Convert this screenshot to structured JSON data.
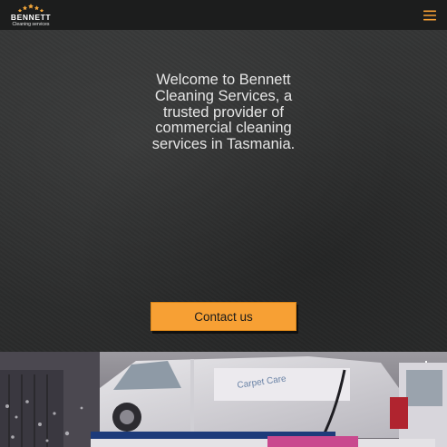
{
  "brand": {
    "name": "BENNETT",
    "tagline": "Cleaning services",
    "star_color": "#f2a63a"
  },
  "header": {
    "menu_icon": "hamburger-menu-icon",
    "menu_icon_color": "#f7a034"
  },
  "hero": {
    "headline": "Welcome to Bennett Cleaning Services, a trusted provider of commercial cleaning services in Tasmania.",
    "cta_label": "Contact us",
    "cta_color": "#f7a034"
  },
  "photo": {
    "van_text": "Carpet Care"
  }
}
